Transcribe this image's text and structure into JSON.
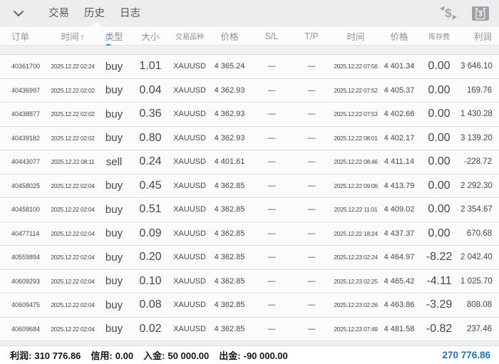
{
  "toolbar": {
    "tabs": [
      {
        "label": "交易",
        "active": false
      },
      {
        "label": "历史",
        "active": true
      },
      {
        "label": "日志",
        "active": false
      }
    ],
    "icons": {
      "chevron": "chevron-down",
      "transfer": "dollar-transfer-arrows",
      "calendar": "calendar"
    },
    "calendar_badge": "3"
  },
  "table": {
    "headers": [
      {
        "label": "订单"
      },
      {
        "label": "时间",
        "sort": "↑"
      },
      {
        "label": "类型"
      },
      {
        "label": "大小"
      },
      {
        "label": "交易品种"
      },
      {
        "label": "价格"
      },
      {
        "label": "S/L"
      },
      {
        "label": "T/P"
      },
      {
        "label": "时间"
      },
      {
        "label": "价格"
      },
      {
        "label": "库存费"
      },
      {
        "label": "利润"
      }
    ],
    "rows": [
      {
        "order": "40361700",
        "open_time": "2025.12.22 02:24",
        "type": "buy",
        "size": "1.01",
        "symbol": "XAUUSD",
        "open_price": "4 365.24",
        "sl": "—",
        "tp": "—",
        "close_time": "2025.12.22 07:56",
        "close_price": "4 401.34",
        "swap": "0.00",
        "profit": "3 646.10"
      },
      {
        "order": "40436997",
        "open_time": "2025.12.22 02:02",
        "type": "buy",
        "size": "0.04",
        "symbol": "XAUUSD",
        "open_price": "4 362.93",
        "sl": "—",
        "tp": "—",
        "close_time": "2025.12.22 07:52",
        "close_price": "4 405.37",
        "swap": "0.00",
        "profit": "169.76"
      },
      {
        "order": "40438877",
        "open_time": "2025.12.22 02:02",
        "type": "buy",
        "size": "0.36",
        "symbol": "XAUUSD",
        "open_price": "4 362.93",
        "sl": "—",
        "tp": "—",
        "close_time": "2025.12.22 07:53",
        "close_price": "4 402.66",
        "swap": "0.00",
        "profit": "1 430.28"
      },
      {
        "order": "40439182",
        "open_time": "2025.12.22 02:02",
        "type": "buy",
        "size": "0.80",
        "symbol": "XAUUSD",
        "open_price": "4 362.93",
        "sl": "—",
        "tp": "—",
        "close_time": "2025.12.22 08:01",
        "close_price": "4 402.17",
        "swap": "0.00",
        "profit": "3 139.20"
      },
      {
        "order": "40443077",
        "open_time": "2025.12.22 08:11",
        "type": "sell",
        "size": "0.24",
        "symbol": "XAUUSD",
        "open_price": "4 401.61",
        "sl": "—",
        "tp": "—",
        "close_time": "2025.12.22 08:46",
        "close_price": "4 411.14",
        "swap": "0.00",
        "profit": "-228.72"
      },
      {
        "order": "40458025",
        "open_time": "2025.12.22 02:04",
        "type": "buy",
        "size": "0.45",
        "symbol": "XAUUSD",
        "open_price": "4 362.85",
        "sl": "—",
        "tp": "—",
        "close_time": "2025.12.22 09:06",
        "close_price": "4 413.79",
        "swap": "0.00",
        "profit": "2 292.30"
      },
      {
        "order": "40458100",
        "open_time": "2025.12.22 02:04",
        "type": "buy",
        "size": "0.51",
        "symbol": "XAUUSD",
        "open_price": "4 362.85",
        "sl": "—",
        "tp": "—",
        "close_time": "2025.12.22 11:01",
        "close_price": "4 409.02",
        "swap": "0.00",
        "profit": "2 354.67"
      },
      {
        "order": "40477114",
        "open_time": "2025.12.22 02:04",
        "type": "buy",
        "size": "0.09",
        "symbol": "XAUUSD",
        "open_price": "4 362.85",
        "sl": "—",
        "tp": "—",
        "close_time": "2025.12.22 18:24",
        "close_price": "4 437.37",
        "swap": "0.00",
        "profit": "670.68"
      },
      {
        "order": "40559894",
        "open_time": "2025.12.22 02:04",
        "type": "buy",
        "size": "0.20",
        "symbol": "XAUUSD",
        "open_price": "4 362.85",
        "sl": "—",
        "tp": "—",
        "close_time": "2025.12.23 02:24",
        "close_price": "4 464.97",
        "swap": "-8.22",
        "profit": "2 042.40"
      },
      {
        "order": "40609293",
        "open_time": "2025.12.22 02:04",
        "type": "buy",
        "size": "0.10",
        "symbol": "XAUUSD",
        "open_price": "4 362.85",
        "sl": "—",
        "tp": "—",
        "close_time": "2025.12.23 02:25",
        "close_price": "4 465.42",
        "swap": "-4.11",
        "profit": "1 025.70"
      },
      {
        "order": "40609475",
        "open_time": "2025.12.22 02:04",
        "type": "buy",
        "size": "0.08",
        "symbol": "XAUUSD",
        "open_price": "4 362.85",
        "sl": "—",
        "tp": "—",
        "close_time": "2025.12.23 02:26",
        "close_price": "4 463.86",
        "swap": "-3.29",
        "profit": "808.08"
      },
      {
        "order": "40609684",
        "open_time": "2025.12.22 02:04",
        "type": "buy",
        "size": "0.02",
        "symbol": "XAUUSD",
        "open_price": "4 362.85",
        "sl": "—",
        "tp": "—",
        "close_time": "2025.12.23 07:49",
        "close_price": "4 481.58",
        "swap": "-0.82",
        "profit": "237.46"
      }
    ]
  },
  "summary": {
    "items": [
      {
        "label": "利润:",
        "value": "310 776.86"
      },
      {
        "label": "信用:",
        "value": "0.00"
      },
      {
        "label": "入金:",
        "value": "50 000.00"
      },
      {
        "label": "出金:",
        "value": "-90 000.00"
      }
    ],
    "total": "270 776.86"
  },
  "colors": {
    "buy": "#1d86e0",
    "sell": "#c62f2f",
    "accent": "#2196f3",
    "total": "#1673cc"
  }
}
